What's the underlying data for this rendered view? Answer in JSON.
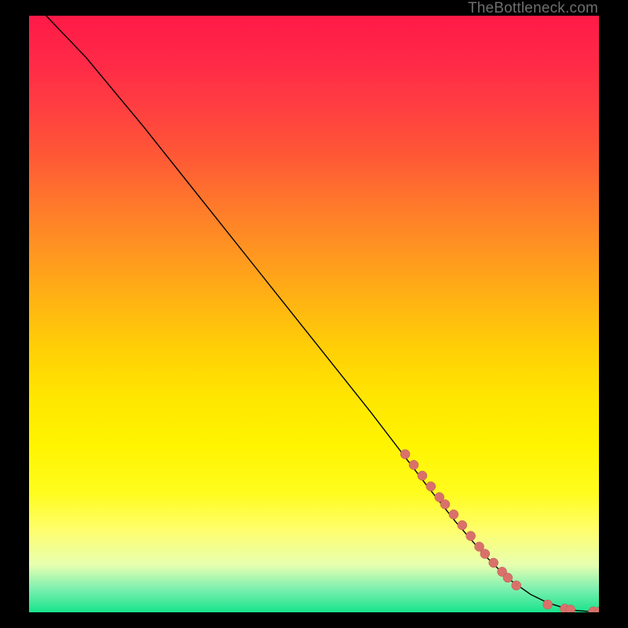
{
  "attribution": "TheBottleneck.com",
  "colors": {
    "dot_fill": "#d9716a",
    "dot_stroke": "#b75a54",
    "curve": "#000000",
    "frame_bg": "#000000"
  },
  "chart_data": {
    "type": "line",
    "title": "",
    "xlabel": "",
    "ylabel": "",
    "xlim": [
      0,
      100
    ],
    "ylim": [
      0,
      100
    ],
    "series": [
      {
        "name": "bottleneck-curve",
        "x": [
          3,
          6,
          10,
          20,
          30,
          40,
          50,
          60,
          66,
          70,
          75,
          80,
          84,
          88,
          91,
          94,
          96,
          98,
          100
        ],
        "y": [
          100,
          97,
          93,
          81.5,
          69.5,
          57.5,
          45.5,
          33.5,
          26,
          21,
          15,
          9.5,
          5.7,
          3.0,
          1.6,
          0.7,
          0.3,
          0.15,
          0.1
        ]
      }
    ],
    "points": [
      {
        "x": 66,
        "y": 26.5
      },
      {
        "x": 67.5,
        "y": 24.7
      },
      {
        "x": 69,
        "y": 22.9
      },
      {
        "x": 70.5,
        "y": 21.1
      },
      {
        "x": 72,
        "y": 19.3
      },
      {
        "x": 73,
        "y": 18.1
      },
      {
        "x": 74.5,
        "y": 16.4
      },
      {
        "x": 76,
        "y": 14.6
      },
      {
        "x": 77.5,
        "y": 12.8
      },
      {
        "x": 79,
        "y": 11.0
      },
      {
        "x": 80,
        "y": 9.8
      },
      {
        "x": 81.5,
        "y": 8.3
      },
      {
        "x": 83,
        "y": 6.8
      },
      {
        "x": 84,
        "y": 5.8
      },
      {
        "x": 85.5,
        "y": 4.5
      },
      {
        "x": 91,
        "y": 1.3
      },
      {
        "x": 94,
        "y": 0.6
      },
      {
        "x": 95,
        "y": 0.45
      },
      {
        "x": 99,
        "y": 0.15
      },
      {
        "x": 100,
        "y": 0.12
      }
    ],
    "gradient_note": "vertical red→orange→yellow→pale→green background encodes value magnitude"
  }
}
